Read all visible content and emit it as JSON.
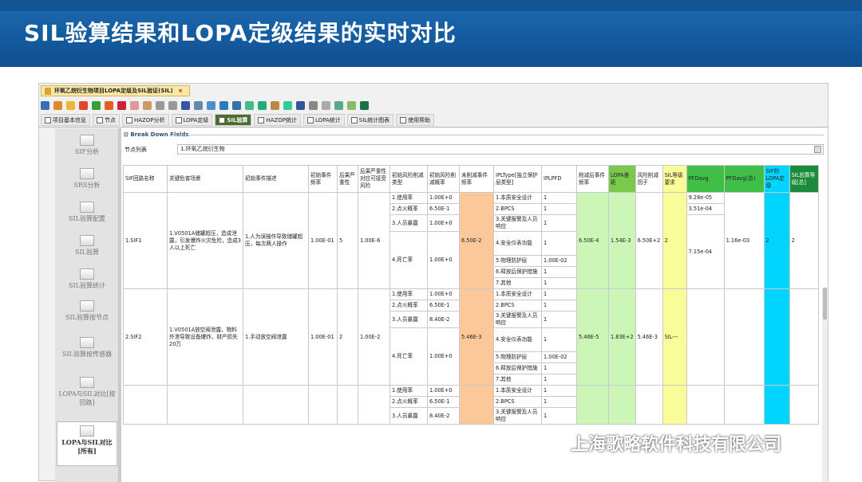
{
  "banner": {
    "title": "SIL验算结果和LOPA定级结果的实时对比"
  },
  "window": {
    "tab_title": "环氧乙烷衍生物项目LOPA定级及SIL验证(SIL)",
    "close": "×"
  },
  "tabs": [
    {
      "label": "项目基本信息",
      "active": false
    },
    {
      "label": "节点",
      "active": false
    },
    {
      "label": "HAZOP分析",
      "active": false
    },
    {
      "label": "LOPA定级",
      "active": false
    },
    {
      "label": "SIL验算",
      "active": true
    },
    {
      "label": "HAZOP统计",
      "active": false
    },
    {
      "label": "LOPA统计",
      "active": false
    },
    {
      "label": "SIL统计图表",
      "active": false
    },
    {
      "label": "使用帮助",
      "active": false
    }
  ],
  "sidebar": [
    {
      "label": "SIF分析"
    },
    {
      "label": "SRS分析"
    },
    {
      "label": "SIL验算配置"
    },
    {
      "label": "SIL验算"
    },
    {
      "label": "SIL验算统计"
    },
    {
      "label": "SIL验算按节点"
    },
    {
      "label": "SIL验算按传感器"
    },
    {
      "label": "LOPA与SIL对比[按回路]"
    },
    {
      "label": "LOPA与SIL对比[所有]"
    }
  ],
  "fieldset": {
    "title": "Break Down Fields",
    "node_label": "节点列表",
    "node_value": "1.环氧乙烷衍生物"
  },
  "headers": [
    "SIF回路名称",
    "关键危害场景",
    "初始事件描述",
    "初始事件频率",
    "后果严重性",
    "后果严重性对应可接受风险",
    "初始风险削减类型",
    "初始风险削减概率",
    "未削减事件频率",
    "IPLType[独立保护层类型]",
    "IPLPFD",
    "削减后事件频率",
    "LOPA差距",
    "风险削减因子",
    "SIL等级要求",
    "PFDavg",
    "PFDavg(总)",
    "SIF的LOPA定级",
    "SIL验算等级[总]"
  ],
  "rows": [
    {
      "sif": "1.SIF1",
      "scenario": "1.V0501A储罐超压，造成泄露，引发爆炸火灾危险，造成3人以上死亡",
      "event": "1.人为误操作导致储罐超压，每次两人操作",
      "freq": "1.00E-01",
      "sev": "5",
      "acc": "1.00E-6",
      "risk": [
        [
          "1.使用率",
          "1.00E+0"
        ],
        [
          "2.点火概率",
          "6.50E-1"
        ],
        [
          "3.人员暴露",
          "1.00E+0"
        ],
        [
          "4.死亡率",
          "1.00E+0"
        ]
      ],
      "unmit": "6.50E-2",
      "ipl": [
        [
          "1.本质安全设计",
          "1"
        ],
        [
          "2.BPCS",
          "1"
        ],
        [
          "3.关键报警及人员响应",
          "1"
        ],
        [
          "4.安全仪表功能",
          "1"
        ],
        [
          "5.物理防护层",
          "1.00E-02"
        ],
        [
          "6.释放后保护措施",
          "1"
        ],
        [
          "7.其他",
          "1"
        ]
      ],
      "mit": "6.50E-4",
      "gap": "1.54E-3",
      "rrf": "6.50E+2",
      "silreq": "2",
      "pfd": [
        "9.28e-05",
        "3.51e-04",
        "7.15e-04"
      ],
      "pfdtotal": "1.16e-03",
      "lopa": "2",
      "silcalc": "2"
    },
    {
      "sif": "2.SIF2",
      "scenario": "1.V0501A放空阀泄露，物料外泄导致设备爆炸，财产损失20万",
      "event": "1.手动放空阀泄露",
      "freq": "1.00E-01",
      "sev": "2",
      "acc": "1.00E-2",
      "risk": [
        [
          "1.使用率",
          "1.00E+0"
        ],
        [
          "2.点火概率",
          "6.50E-1"
        ],
        [
          "3.人员暴露",
          "8.40E-2"
        ],
        [
          "4.死亡率",
          "1.00E+0"
        ]
      ],
      "unmit": "5.46E-3",
      "ipl": [
        [
          "1.本质安全设计",
          "1"
        ],
        [
          "2.BPCS",
          "1"
        ],
        [
          "3.关键报警及人员响应",
          "1"
        ],
        [
          "4.安全仪表功能",
          "1"
        ],
        [
          "5.物理防护层",
          "1.00E-02"
        ],
        [
          "6.释放后保护措施",
          "1"
        ],
        [
          "7.其他",
          "1"
        ]
      ],
      "mit": "5.46E-5",
      "gap": "1.83E+2",
      "rrf": "5.46E-3",
      "silreq": "SIL---",
      "pfd": [],
      "pfdtotal": "",
      "lopa": "",
      "silcalc": ""
    },
    {
      "sif": "",
      "scenario": "",
      "event": "",
      "freq": "",
      "sev": "",
      "acc": "",
      "risk": [
        [
          "1.使用率",
          "1.00E+0"
        ],
        [
          "2.点火概率",
          "6.50E-1"
        ],
        [
          "3.人员暴露",
          "8.40E-2"
        ]
      ],
      "unmit": "",
      "ipl": [
        [
          "1.本质安全设计",
          "1"
        ],
        [
          "2.BPCS",
          "1"
        ],
        [
          "3.关键报警及人员响应",
          "1"
        ]
      ],
      "mit": "",
      "gap": "",
      "rrf": "",
      "silreq": "",
      "pfd": [],
      "pfdtotal": "",
      "lopa": "",
      "silcalc": ""
    }
  ],
  "watermark": "上海歌略软件科技有限公司"
}
